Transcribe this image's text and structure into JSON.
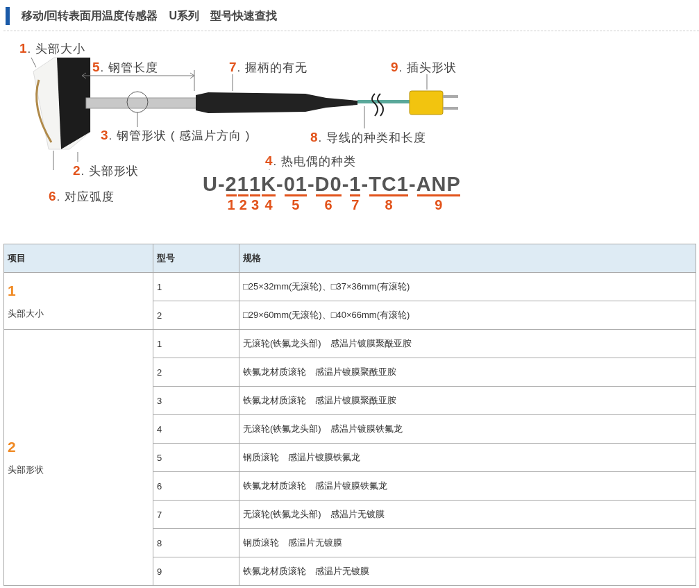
{
  "title": "移动/回转表面用温度传感器　U系列　型号快速查找",
  "diagram": {
    "labels": [
      {
        "kind": "head_size",
        "number": "1",
        "text": ". 头部大小"
      },
      {
        "kind": "tube_length",
        "number": "5",
        "text": ". 钢管长度"
      },
      {
        "kind": "grip",
        "number": "7",
        "text": ". 握柄的有无"
      },
      {
        "kind": "plug",
        "number": "9",
        "text": ". 插头形状"
      },
      {
        "kind": "tube_shape",
        "number": "3",
        "text": ". 钢管形状 ( 感温片方向 )"
      },
      {
        "kind": "lead",
        "number": "8",
        "text": ". 导线的种类和长度"
      },
      {
        "kind": "head_shape",
        "number": "2",
        "text": ". 头部形状"
      },
      {
        "kind": "thermocouple",
        "number": "4",
        "text": ". 热电偶的种类"
      },
      {
        "kind": "curvature",
        "number": "6",
        "text": ". 对应弧度"
      }
    ],
    "code_parts": [
      {
        "text": "U-"
      },
      {
        "text": "2",
        "number": "1"
      },
      {
        "text": "1",
        "number": "2"
      },
      {
        "text": "1",
        "number": "3"
      },
      {
        "text": "K",
        "number": "4"
      },
      {
        "text": "-"
      },
      {
        "text": "01",
        "number": "5"
      },
      {
        "text": "-"
      },
      {
        "text": "D0",
        "number": "6"
      },
      {
        "text": "-"
      },
      {
        "text": "1",
        "number": "7"
      },
      {
        "text": "-"
      },
      {
        "text": "TC1",
        "number": "8"
      },
      {
        "text": "-"
      },
      {
        "text": "ANP",
        "number": "9"
      }
    ]
  },
  "table": {
    "columns": [
      "项目",
      "型号",
      "规格"
    ],
    "groups": [
      {
        "number": "1",
        "name": "头部大小",
        "rows": [
          {
            "code": "1",
            "spec": "□25×32mm(无滚轮)、□37×36mm(有滚轮)"
          },
          {
            "code": "2",
            "spec": "□29×60mm(无滚轮)、□40×66mm(有滚轮)"
          }
        ]
      },
      {
        "number": "2",
        "name": "头部形状",
        "rows": [
          {
            "code": "1",
            "spec": "无滚轮(铁氟龙头部)　感温片镀膜聚酰亚胺"
          },
          {
            "code": "2",
            "spec": "铁氟龙材质滚轮　感温片镀膜聚酰亚胺"
          },
          {
            "code": "3",
            "spec": "铁氟龙材质滚轮　感温片镀膜聚酰亚胺"
          },
          {
            "code": "4",
            "spec": "无滚轮(铁氟龙头部)　感温片镀膜铁氟龙"
          },
          {
            "code": "5",
            "spec": "钢质滚轮　感温片镀膜铁氟龙"
          },
          {
            "code": "6",
            "spec": "铁氟龙材质滚轮　感温片镀膜铁氟龙"
          },
          {
            "code": "7",
            "spec": "无滚轮(铁氟龙头部)　感温片无镀膜"
          },
          {
            "code": "8",
            "spec": "钢质滚轮　感温片无镀膜"
          },
          {
            "code": "9",
            "spec": "铁氟龙材质滚轮　感温片无镀膜"
          }
        ]
      }
    ]
  }
}
